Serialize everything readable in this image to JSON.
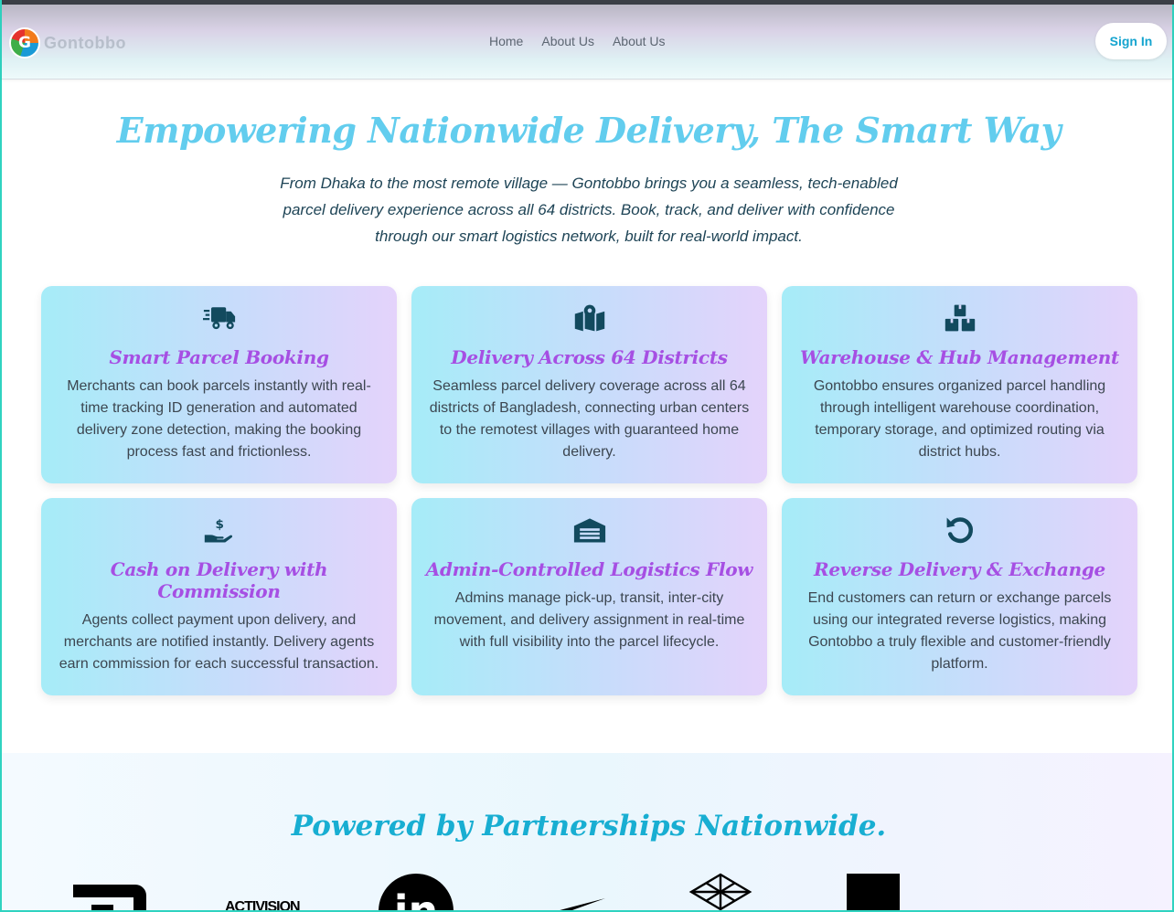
{
  "brand": {
    "name": "Gontobbo",
    "logo_letter": "G"
  },
  "nav": {
    "links": [
      "Home",
      "About Us",
      "About Us"
    ],
    "signin_label": "Sign In"
  },
  "hero": {
    "title": "Empowering Nationwide Delivery, The Smart Way",
    "subtitle": "From Dhaka to the most remote village — Gontobbo brings you a seamless, tech-enabled parcel delivery experience across all 64 districts. Book, track, and deliver with confidence through our smart logistics network, built for real-world impact."
  },
  "features": [
    {
      "icon": "truck-fast-icon",
      "title": "Smart Parcel Booking",
      "desc": "Merchants can book parcels instantly with real-time tracking ID generation and automated delivery zone detection, making the booking process fast and frictionless."
    },
    {
      "icon": "map-location-icon",
      "title": "Delivery Across 64 Districts",
      "desc": "Seamless parcel delivery coverage across all 64 districts of Bangladesh, connecting urban centers to the remotest villages with guaranteed home delivery."
    },
    {
      "icon": "boxes-stacked-icon",
      "title": "Warehouse & Hub Management",
      "desc": "Gontobbo ensures organized parcel handling through intelligent warehouse coordination, temporary storage, and optimized routing via district hubs."
    },
    {
      "icon": "hand-holding-dollar-icon",
      "title": "Cash on Delivery with Commission",
      "desc": "Agents collect payment upon delivery, and merchants are notified instantly. Delivery agents earn commission for each successful transaction."
    },
    {
      "icon": "warehouse-icon",
      "title": "Admin-Controlled Logistics Flow",
      "desc": "Admins manage pick-up, transit, inter-city movement, and delivery assignment in real-time with full visibility into the parcel lifecycle."
    },
    {
      "icon": "rotate-left-icon",
      "title": "Reverse Delivery & Exchange",
      "desc": "End customers can return or exchange parcels using our integrated reverse logistics, making Gontobbo a truly flexible and customer-friendly platform."
    }
  ],
  "partners": {
    "title": "Powered by Partnerships Nationwide.",
    "logos": [
      "abbott-logo",
      "activision-logo",
      "linkedin-logo",
      "nike-logo",
      "geometric-logo",
      "square-logo"
    ],
    "logo_texts": [
      "ACTIVISION",
      "in"
    ]
  },
  "colors": {
    "accent": "#62cdee",
    "card_title": "#a64fe3",
    "icon": "#124a5e",
    "signin_text": "#15a4cf"
  }
}
